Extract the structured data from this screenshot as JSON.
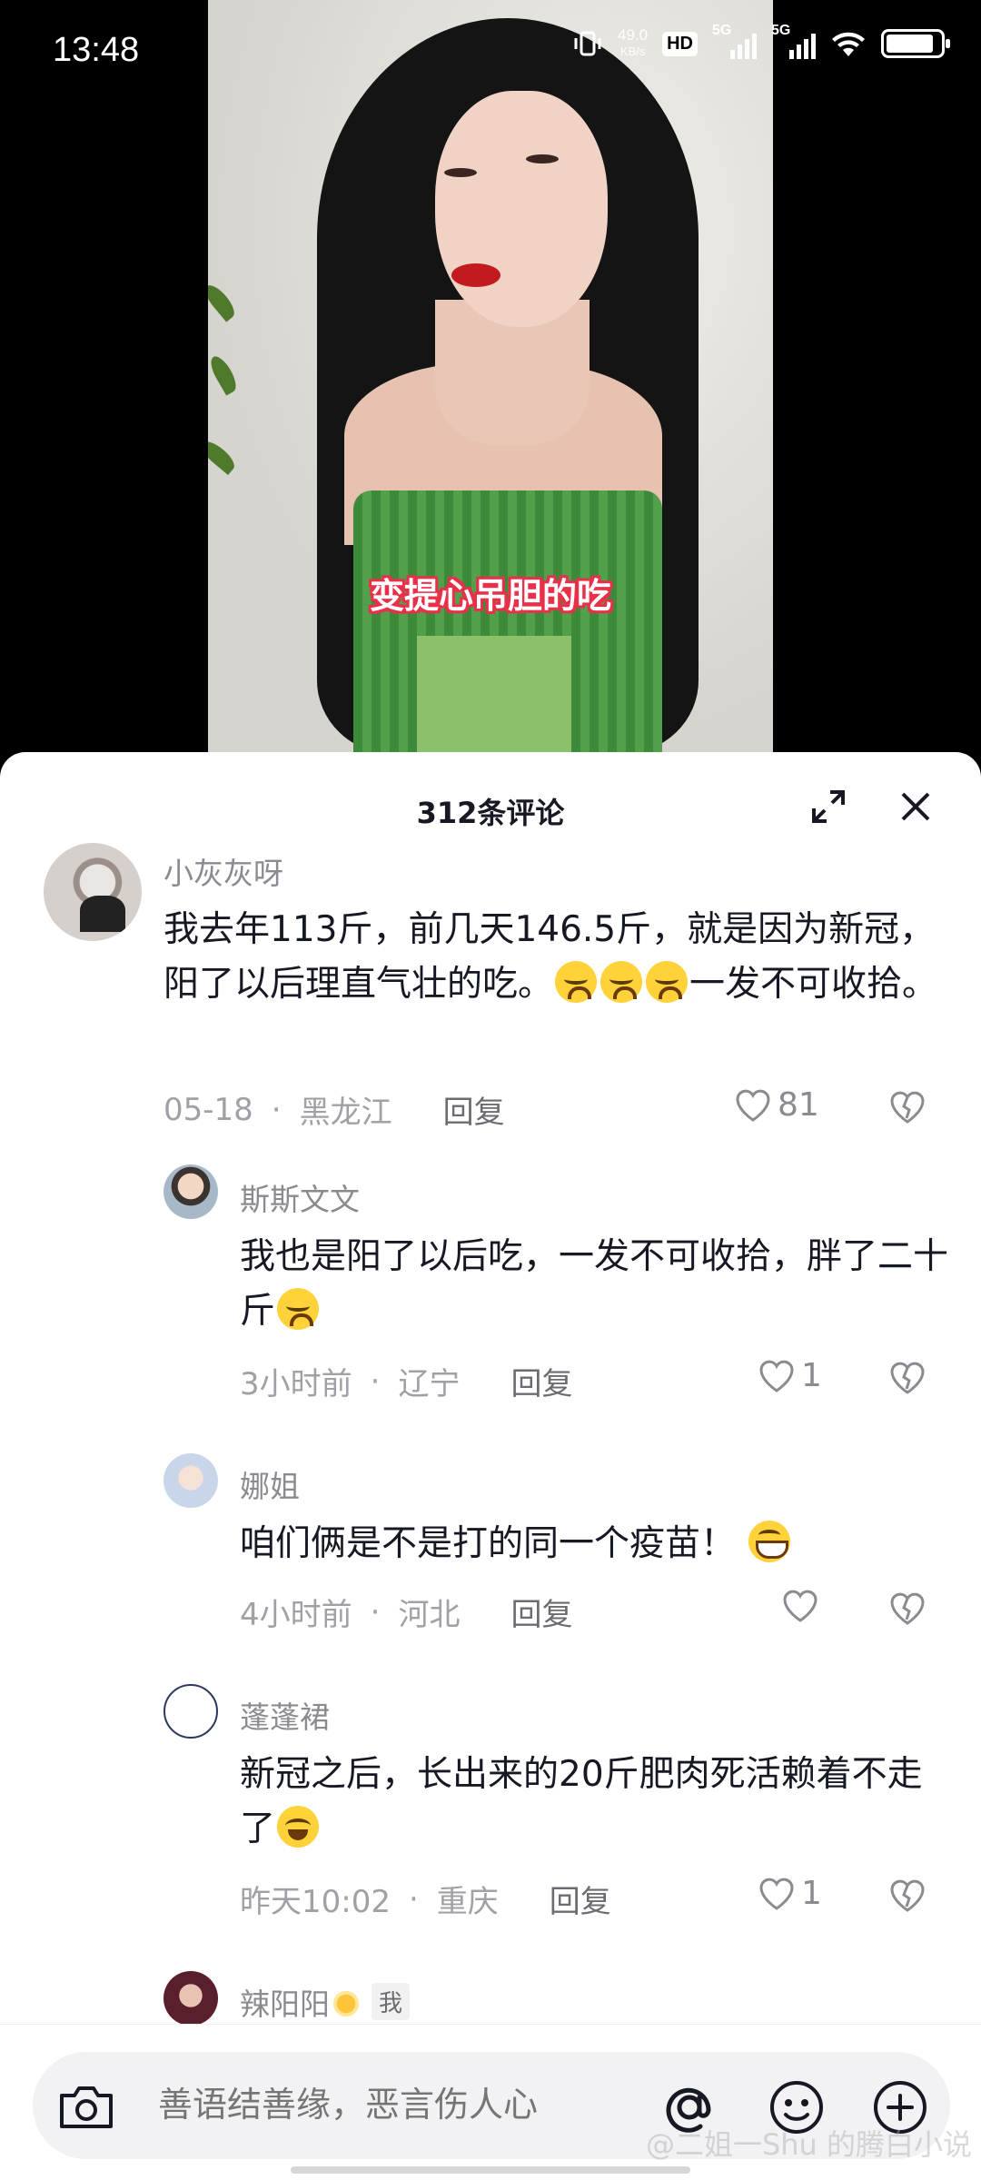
{
  "status_bar": {
    "time": "13:48",
    "net_speed_value": "49.0",
    "net_speed_unit": "KB/s",
    "hd_label": "HD",
    "sim1_label": "5G",
    "sim2_label": "5G"
  },
  "video": {
    "caption": "变提心吊胆的吃"
  },
  "sheet": {
    "title": "312条评论"
  },
  "comments": [
    {
      "username": "小灰灰呀",
      "text_before": "我去年113斤，前几天146.5斤，就是因为新冠，阳了以后理直气壮的吃。",
      "text_after": "一发不可收拾。",
      "date": "05-18",
      "location": "黑龙江",
      "reply_label": "回复",
      "likes": "81"
    },
    {
      "username": "斯斯文文",
      "text_before": "我也是阳了以后吃，一发不可收拾，胖了二十斤",
      "date": "3小时前",
      "location": "辽宁",
      "reply_label": "回复",
      "likes": "1"
    },
    {
      "username": "娜姐",
      "text_before": "咱们俩是不是打的同一个疫苗！",
      "date": "4小时前",
      "location": "河北",
      "reply_label": "回复",
      "likes": ""
    },
    {
      "username": "蓬蓬裙",
      "text_before": "新冠之后，长出来的20斤肥肉死活赖着不走了",
      "date": "昨天10:02",
      "location": "重庆",
      "reply_label": "回复",
      "likes": "1"
    },
    {
      "username": "辣阳阳",
      "me_badge": "我"
    }
  ],
  "input_bar": {
    "placeholder": "善语结善缘，恶言伤人心"
  },
  "watermark": "@二姐一Shu 的腾白小说"
}
